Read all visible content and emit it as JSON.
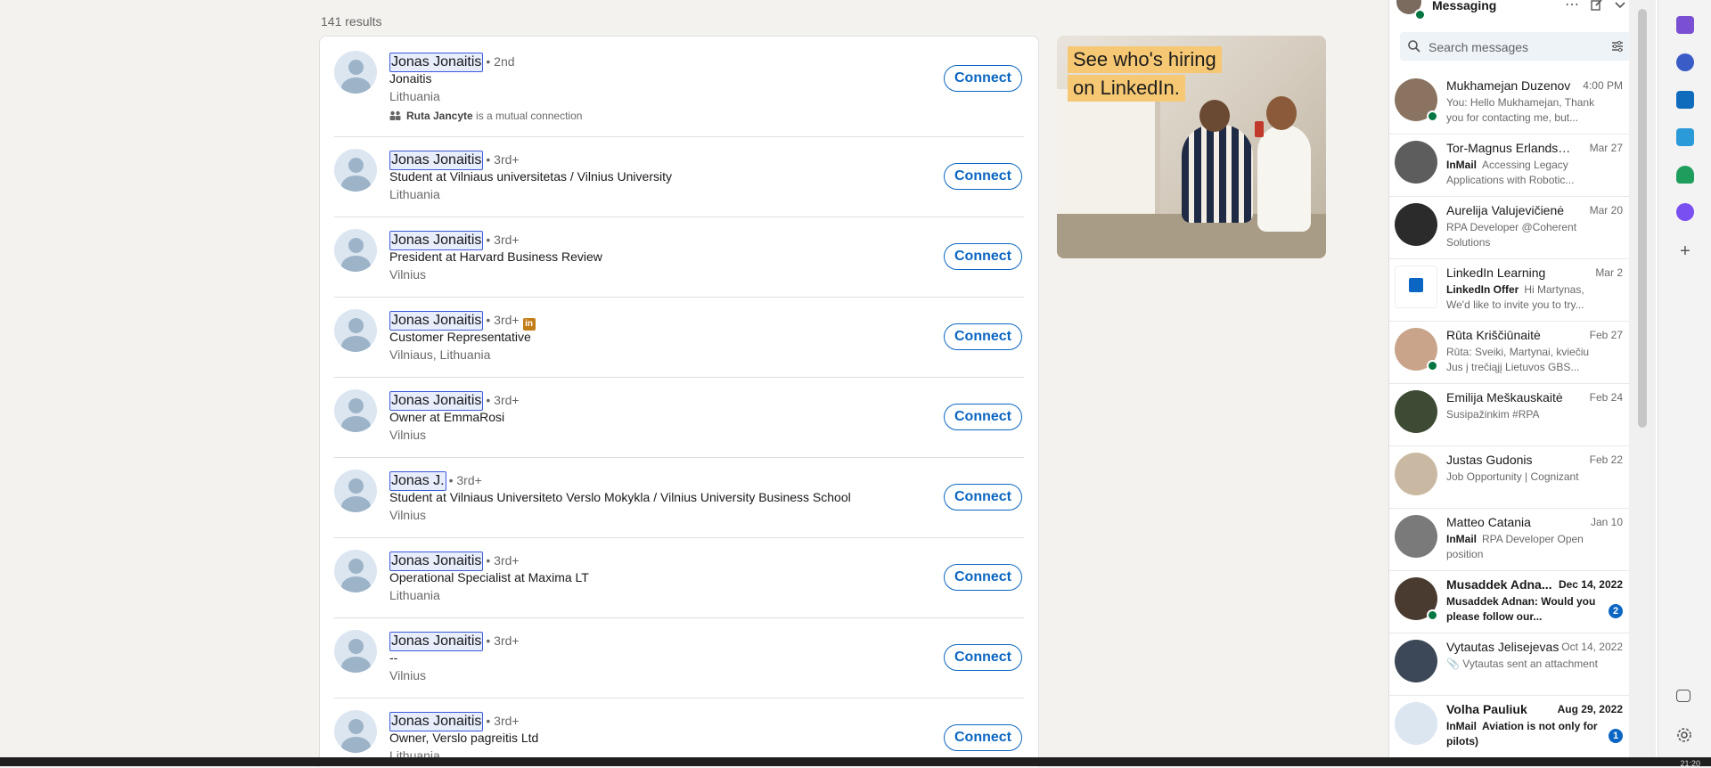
{
  "results": {
    "count_label": "141 results",
    "items": [
      {
        "name": "Jonas Jonaitis",
        "degree": "• 2nd",
        "headline": "Jonaitis",
        "location": "Lithuania",
        "mutual_name": "Ruta Jancyte",
        "mutual_text": " is a mutual connection",
        "connect": "Connect",
        "badge": false
      },
      {
        "name": "Jonas Jonaitis",
        "degree": "• 3rd+",
        "headline": "Student at Vilniaus universitetas / Vilnius University",
        "location": "Lithuania",
        "connect": "Connect",
        "badge": false
      },
      {
        "name": "Jonas Jonaitis",
        "degree": "• 3rd+",
        "headline": "President at Harvard Business Review",
        "location": "Vilnius",
        "connect": "Connect",
        "badge": false
      },
      {
        "name": "Jonas Jonaitis",
        "degree": "• 3rd+",
        "headline": "Customer Representative",
        "location": "Vilniaus, Lithuania",
        "connect": "Connect",
        "badge": true
      },
      {
        "name": "Jonas Jonaitis",
        "degree": "• 3rd+",
        "headline": "Owner at EmmaRosi",
        "location": "Vilnius",
        "connect": "Connect",
        "badge": false
      },
      {
        "name": "Jonas J.",
        "degree": "• 3rd+",
        "headline": "Student at Vilniaus Universiteto Verslo Mokykla / Vilnius University Business School",
        "location": "Vilnius",
        "connect": "Connect",
        "badge": false
      },
      {
        "name": "Jonas Jonaitis",
        "degree": "• 3rd+",
        "headline": "Operational Specialist at Maxima LT",
        "location": "Lithuania",
        "connect": "Connect",
        "badge": false
      },
      {
        "name": "Jonas Jonaitis",
        "degree": "• 3rd+",
        "headline": "--",
        "location": "Vilnius",
        "connect": "Connect",
        "badge": false
      },
      {
        "name": "Jonas Jonaitis",
        "degree": "• 3rd+",
        "headline": "Owner, Verslo pagreitis Ltd",
        "location": "Lithuania",
        "connect": "Connect",
        "badge": false
      }
    ]
  },
  "ad": {
    "line1": "See who's hiring",
    "line2": "on LinkedIn."
  },
  "messaging": {
    "title": "Messaging",
    "search_placeholder": "Search messages",
    "conversations": [
      {
        "name": "Mukhamejan Duzenov",
        "date": "4:00 PM",
        "prefix": "",
        "snippet": "You: Hello Mukhamejan, Thank you for contacting me, but...",
        "online": true,
        "unread": false,
        "color": "#8a7360"
      },
      {
        "name": "Tor-Magnus Erlandsen",
        "date": "Mar 27",
        "prefix": "InMail",
        "snippet": "Accessing Legacy Applications with Robotic...",
        "online": false,
        "unread": false,
        "color": "#5d5d5d"
      },
      {
        "name": "Aurelija Valujevičienė",
        "date": "Mar 20",
        "prefix": "",
        "snippet": "RPA Developer @Coherent Solutions",
        "online": false,
        "unread": false,
        "color": "#2b2b2b"
      },
      {
        "name": "LinkedIn Learning",
        "date": "Mar 2",
        "prefix": "LinkedIn Offer",
        "snippet": "Hi Martynas, We'd like to invite you to try...",
        "online": false,
        "unread": false,
        "color": "logo"
      },
      {
        "name": "Rūta Kriščiūnaitė",
        "date": "Feb 27",
        "prefix": "",
        "snippet": "Rūta: Sveiki, Martynai,  kviečiu Jus į trečiąjį Lietuvos GBS...",
        "online": true,
        "unread": false,
        "color": "#c9a48a"
      },
      {
        "name": "Emilija Meškauskaitė",
        "date": "Feb 24",
        "prefix": "",
        "snippet": "Susipažinkim #RPA",
        "online": false,
        "unread": false,
        "color": "#3d4a34"
      },
      {
        "name": "Justas Gudonis",
        "date": "Feb 22",
        "prefix": "",
        "snippet": "Job Opportunity | Cognizant",
        "online": false,
        "unread": false,
        "color": "#c9b9a3"
      },
      {
        "name": "Matteo Catania",
        "date": "Jan 10",
        "prefix": "InMail",
        "snippet": "RPA Developer Open position",
        "online": false,
        "unread": false,
        "color": "#7a7a7a"
      },
      {
        "name": "Musaddek Adna...",
        "date": "Dec 14, 2022",
        "prefix": "",
        "snippet": "Musaddek Adnan: Would you please follow our...",
        "online": true,
        "unread": true,
        "badge": "2",
        "color": "#4a3b30"
      },
      {
        "name": "Vytautas Jelisejevas",
        "date": "Oct 14, 2022",
        "prefix": "",
        "snippet": "Vytautas sent an attachment",
        "online": false,
        "unread": false,
        "attach": true,
        "color": "#3c4757"
      },
      {
        "name": "Volha Pauliuk",
        "date": "Aug 29, 2022",
        "prefix": "InMail",
        "snippet": "Aviation is not only for pilots)",
        "online": false,
        "unread": true,
        "badge": "1",
        "color": "#dce6f1"
      }
    ]
  },
  "taskbar": {
    "clock": "21:20"
  }
}
